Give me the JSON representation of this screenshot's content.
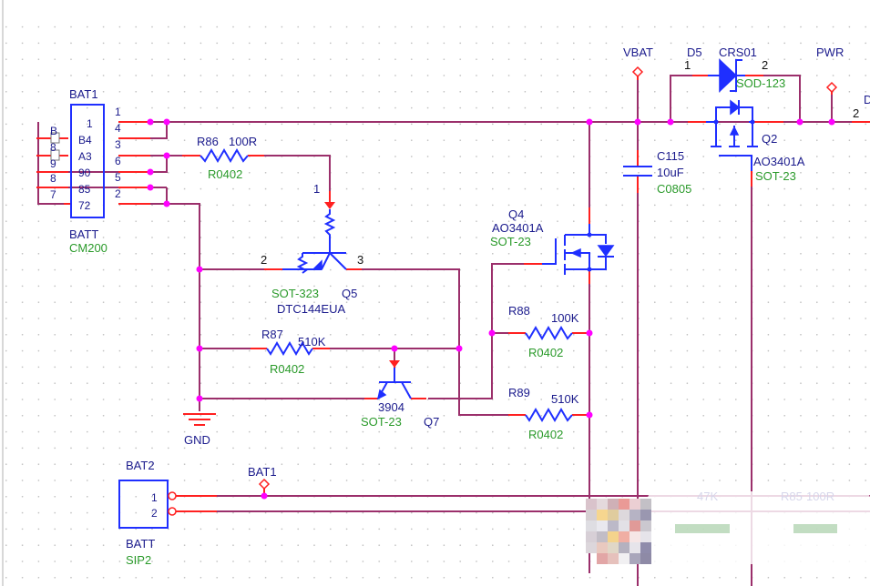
{
  "schematic": {
    "grid": "dotted",
    "colors": {
      "wire": "#9b2f6b",
      "pin_lead": "#ff2020",
      "component_body": "#1f2fff",
      "junction": "#ff00ff",
      "designator_text": "#1a1a8c",
      "footprint_text": "#2a9a2a"
    },
    "components": {
      "bat1": {
        "ref": "BAT1",
        "value": "BATT",
        "footprint": "CM200",
        "left_pins": [
          "B",
          "8",
          "9",
          "8",
          "7"
        ],
        "inner_pins": [
          "1",
          "B4",
          "A3",
          "90",
          "85",
          "72"
        ],
        "right_pins": [
          "1",
          "4",
          "3",
          "6",
          "5",
          "2"
        ]
      },
      "r86": {
        "ref": "R86",
        "value": "100R",
        "footprint": "R0402"
      },
      "q5": {
        "ref": "Q5",
        "value": "DTC144EUA",
        "footprint": "SOT-323",
        "pins": [
          "1",
          "2",
          "3"
        ]
      },
      "r87": {
        "ref": "R87",
        "value": "510K",
        "footprint": "R0402"
      },
      "q7": {
        "ref": "Q7",
        "value": "3904",
        "footprint": "SOT-23"
      },
      "gnd": {
        "label": "GND"
      },
      "q4": {
        "ref": "Q4",
        "value": "AO3401A",
        "footprint": "SOT-23"
      },
      "r88": {
        "ref": "R88",
        "value": "100K",
        "footprint": "R0402"
      },
      "r89": {
        "ref": "R89",
        "value": "510K",
        "footprint": "R0402"
      },
      "c115": {
        "ref": "C115",
        "value": "10uF",
        "footprint": "C0805"
      },
      "d5": {
        "ref": "D5",
        "value": "CRS01",
        "footprint": "SOD-123",
        "pins": [
          "1",
          "2"
        ]
      },
      "q2": {
        "ref": "Q2",
        "value": "AO3401A",
        "footprint": "SOT-23"
      },
      "bat2": {
        "ref": "BAT2",
        "value": "BATT",
        "footprint": "SIP2",
        "pins": [
          "1",
          "2"
        ]
      },
      "partial_r_left": {
        "value": "47K"
      },
      "partial_r_right": {
        "ref": "R85",
        "value": "100R"
      }
    },
    "net_labels": {
      "vbat": "VBAT",
      "pwr": "PWR",
      "bat1": "BAT1"
    },
    "offscreen_partial": {
      "pin": "2",
      "ref_fragment": "D"
    }
  }
}
